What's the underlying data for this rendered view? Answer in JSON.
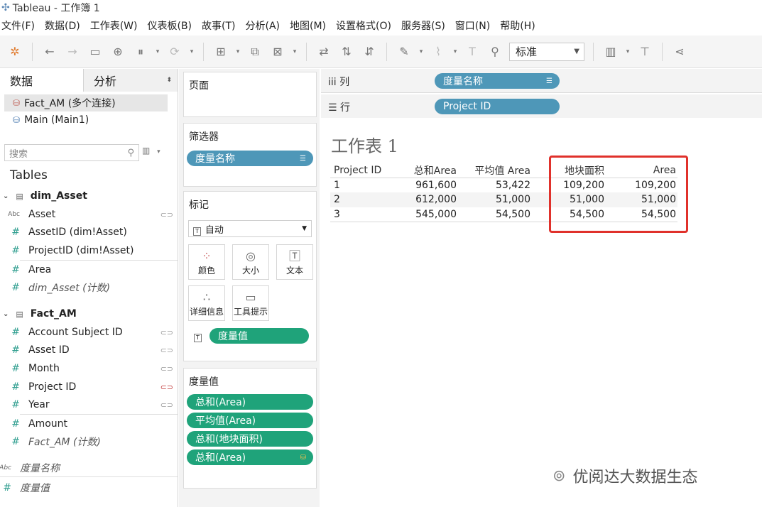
{
  "window": {
    "title": "Tableau - 工作簿 1"
  },
  "menu": [
    "文件(F)",
    "数据(D)",
    "工作表(W)",
    "仪表板(B)",
    "故事(T)",
    "分析(A)",
    "地图(M)",
    "设置格式(O)",
    "服务器(S)",
    "窗口(N)",
    "帮助(H)"
  ],
  "toolbar": {
    "fit_mode": "标准"
  },
  "left_pane": {
    "tab_data": "数据",
    "tab_analysis": "分析",
    "connections": [
      {
        "name": "Fact_AM (多个连接)"
      },
      {
        "name": "Main (Main1)"
      }
    ],
    "search_placeholder": "搜索",
    "tables_label": "Tables",
    "groups": [
      {
        "name": "dim_Asset",
        "fields": [
          {
            "icon": "Abc",
            "name": "Asset"
          },
          {
            "icon": "#",
            "name": "AssetID (dim!Asset)"
          },
          {
            "icon": "#",
            "name": "ProjectID (dim!Asset)"
          },
          {
            "icon": "#",
            "name": "Area"
          },
          {
            "icon": "#",
            "name": "dim_Asset (计数)"
          }
        ]
      },
      {
        "name": "Fact_AM",
        "fields": [
          {
            "icon": "#",
            "name": "Account Subject ID"
          },
          {
            "icon": "#",
            "name": "Asset ID"
          },
          {
            "icon": "#",
            "name": "Month"
          },
          {
            "icon": "#",
            "name": "Project ID"
          },
          {
            "icon": "#",
            "name": "Year"
          },
          {
            "icon": "#",
            "name": "Amount"
          },
          {
            "icon": "#",
            "name": "Fact_AM (计数)"
          }
        ]
      }
    ],
    "measure_names": "度量名称",
    "measure_values": "度量值"
  },
  "middle_pane": {
    "pages_label": "页面",
    "filters_label": "筛选器",
    "filter_pill": "度量名称",
    "marks_label": "标记",
    "marks_type": "自动",
    "mark_buttons": [
      "颜色",
      "大小",
      "文本",
      "详细信息",
      "工具提示"
    ],
    "marks_pill": "度量值",
    "measure_values_label": "度量值",
    "measure_value_pills": [
      "总和(Area)",
      "平均值(Area)",
      "总和(地块面积)",
      "总和(Area)"
    ]
  },
  "shelves": {
    "columns_label": "列",
    "columns_pill": "度量名称",
    "rows_label": "行",
    "rows_pill": "Project ID"
  },
  "sheet": {
    "title": "工作表 1",
    "columns": [
      "Project ID",
      "总和Area",
      "平均值 Area",
      "地块面积",
      "Area"
    ],
    "rows": [
      [
        "1",
        "961,600",
        "53,422",
        "109,200",
        "109,200"
      ],
      [
        "2",
        "612,000",
        "51,000",
        "51,000",
        "51,000"
      ],
      [
        "3",
        "545,000",
        "54,500",
        "54,500",
        "54,500"
      ]
    ]
  },
  "watermark": "优阅达大数据生态"
}
